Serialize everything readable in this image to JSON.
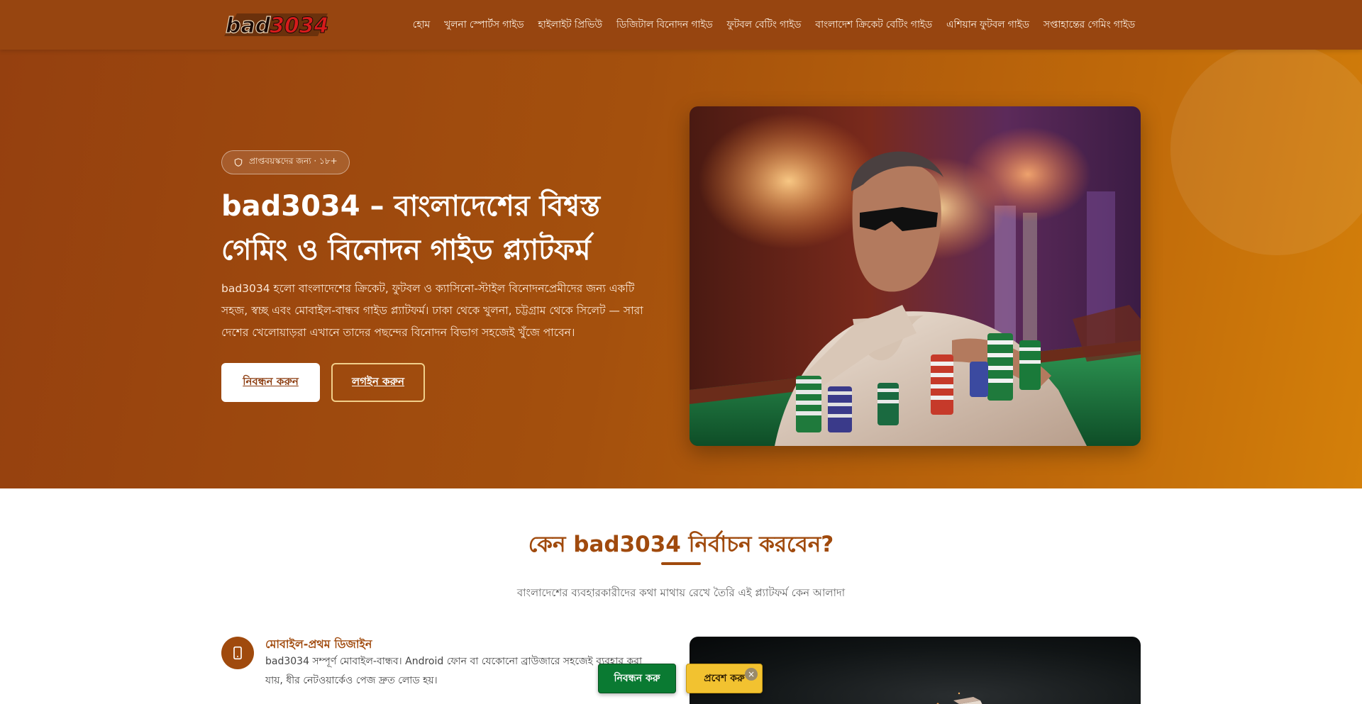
{
  "header": {
    "logo_text": "bad3034",
    "nav": [
      {
        "label": "হোম"
      },
      {
        "label": "খুলনা স্পোর্টস গাইড"
      },
      {
        "label": "হাইলাইট প্রিভিউ"
      },
      {
        "label": "ডিজিটাল বিনোদন গাইড"
      },
      {
        "label": "ফুটবল বেটিং গাইড"
      },
      {
        "label": "বাংলাদেশ ক্রিকেট বেটিং গাইড"
      },
      {
        "label": "এশিয়ান ফুটবল গাইড"
      },
      {
        "label": "সপ্তাহান্তের গেমিং গাইড"
      }
    ]
  },
  "hero": {
    "badge": "প্রাপ্তবয়স্কদের জন্য · ১৮+",
    "title": "bad3034 – বাংলাদেশের বিশ্বস্ত গেমিং ও বিনোদন গাইড প্ল্যাটফর্ম",
    "description": "bad3034 হলো বাংলাদেশের ক্রিকেট, ফুটবল ও ক্যাসিনো-স্টাইল বিনোদনপ্রেমীদের জন্য একটি সহজ, স্বচ্ছ এবং মোবাইল-বান্ধব গাইড প্ল্যাটফর্ম। ঢাকা থেকে খুলনা, চট্টগ্রাম থেকে সিলেট — সারা দেশের খেলোয়াড়রা এখানে তাদের পছন্দের বিনোদন বিভাগ সহজেই খুঁজে পাবেন।",
    "register_label": "নিবন্ধন করুন",
    "login_label": "লগইন করুন"
  },
  "why": {
    "title": "কেন bad3034 নির্বাচন করবেন?",
    "subtitle": "বাংলাদেশের ব্যবহারকারীদের কথা মাথায় রেখে তৈরি এই প্ল্যাটফর্ম কেন আলাদা",
    "feature": {
      "title": "মোবাইল-প্রথম ডিজাইন",
      "description": "bad3034 সম্পূর্ণ মোবাইল-বান্ধব। Android ফোন বা যেকোনো ব্রাউজারে সহজেই ব্যবহার করা যায়, ধীর নেটওয়ার্কেও পেজ দ্রুত লোড হয়।"
    }
  },
  "floating": {
    "register_label": "নিবন্ধন করু",
    "login_label": "প্রবেশ করু",
    "close_symbol": "×"
  },
  "colors": {
    "header_bg": "#974510",
    "accent": "#a04a0d",
    "float_register": "#0a7a32",
    "float_login": "#f2c230"
  }
}
